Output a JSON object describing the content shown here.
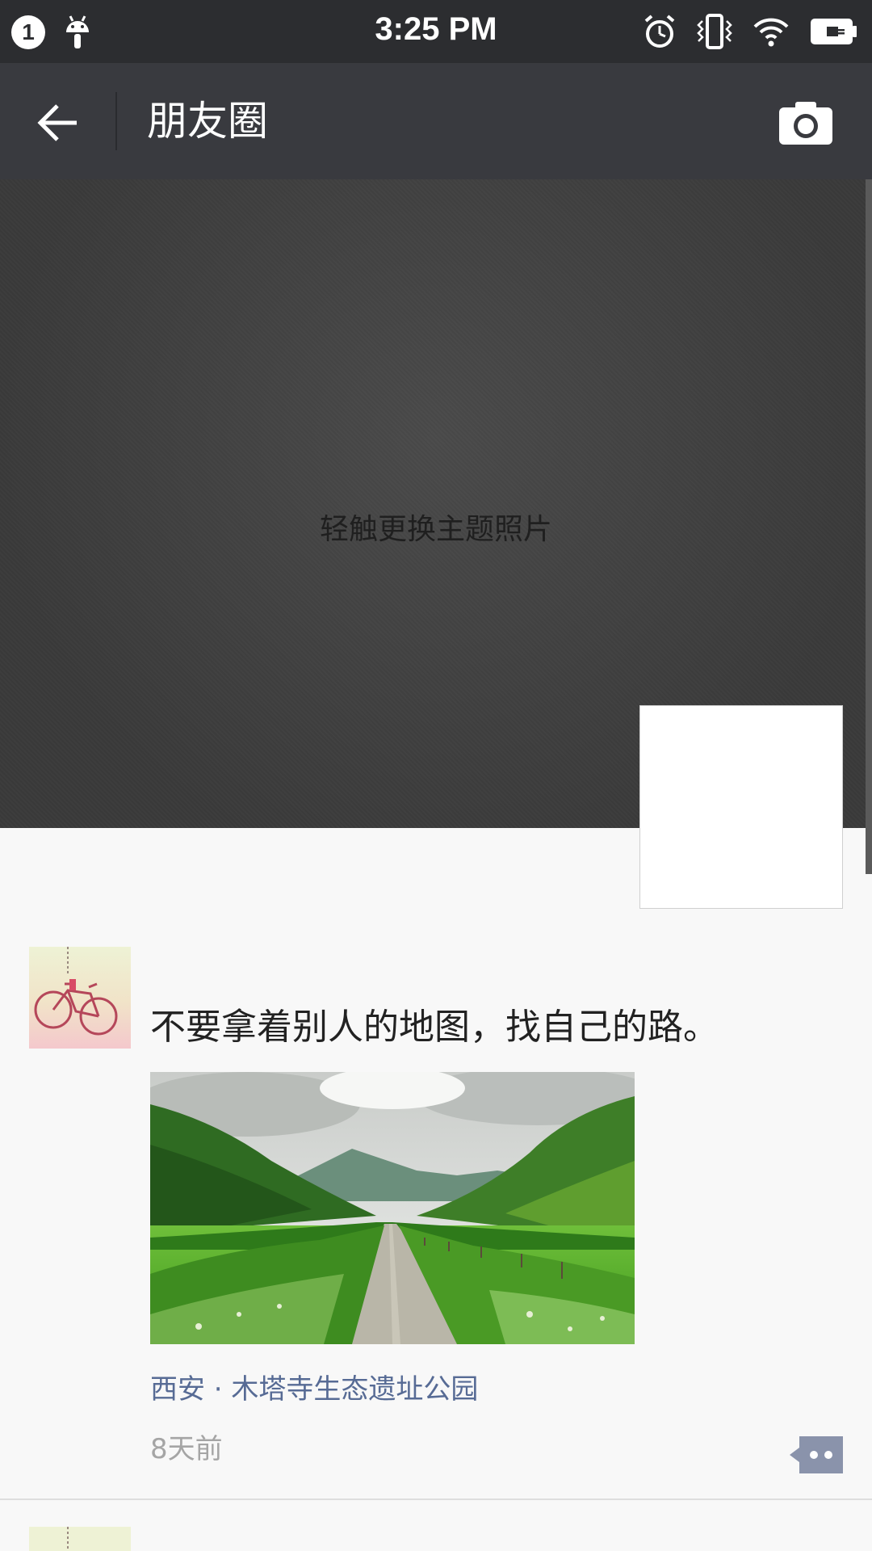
{
  "status_bar": {
    "notification_count": "1",
    "time": "3:25 PM",
    "icons": [
      "notification-badge-icon",
      "android-icon",
      "alarm-icon",
      "vibrate-icon",
      "wifi-icon",
      "battery-icon"
    ]
  },
  "header": {
    "title": "朋友圈",
    "back_icon": "back-arrow-icon",
    "camera_icon": "camera-icon"
  },
  "cover": {
    "hint": "轻触更换主题照片"
  },
  "post": {
    "text": "不要拿着别人的地图，找自己的路。",
    "location": "西安 · 木塔寺生态遗址公园",
    "time": "8天前",
    "avatar_icon": "bicycle-avatar",
    "image_icon": "countryside-road-image",
    "comment_icon": "comment-more-icon"
  },
  "colors": {
    "status_bar_bg": "#2c2d30",
    "header_bg": "#393a3f",
    "link_color": "#576b95",
    "time_color": "#a5a5a5"
  }
}
